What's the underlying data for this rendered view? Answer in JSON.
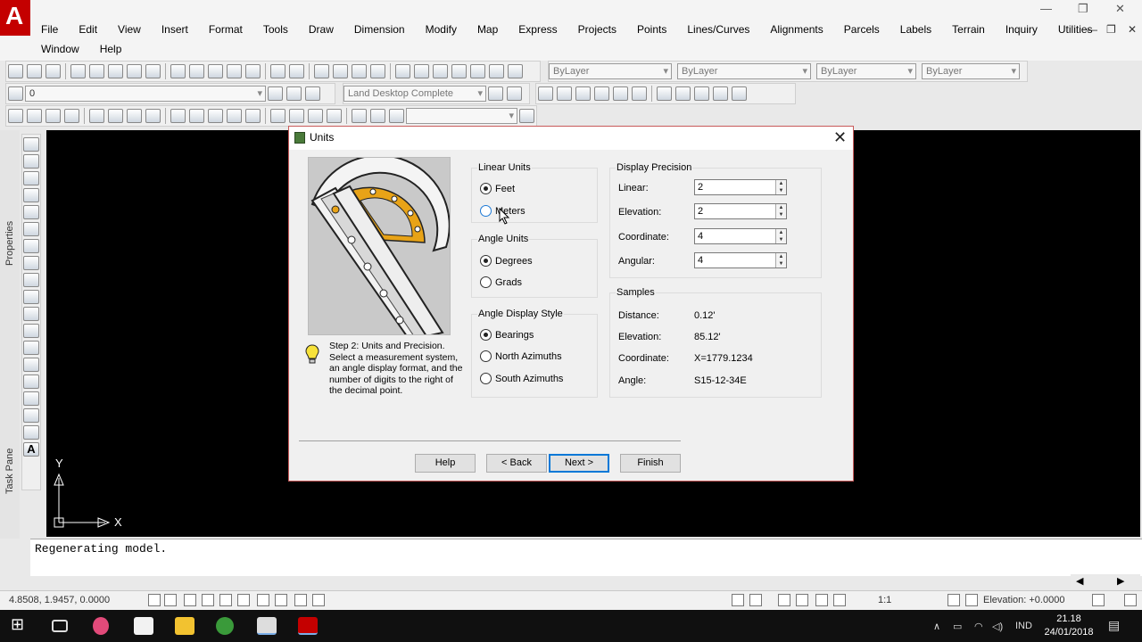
{
  "menu": {
    "row1": [
      "File",
      "Edit",
      "View",
      "Insert",
      "Format",
      "Tools",
      "Draw",
      "Dimension",
      "Modify",
      "Map",
      "Express",
      "Projects",
      "Points",
      "Lines/Curves",
      "Alignments",
      "Parcels",
      "Labels",
      "Terrain",
      "Inquiry",
      "Utilities"
    ],
    "row2": [
      "Window",
      "Help"
    ]
  },
  "toolbar": {
    "layer_value": "0",
    "workspace": "Land Desktop Complete",
    "color_combo": "ByLayer",
    "linetype_combo": "ByLayer",
    "lineweight_combo": "ByLayer",
    "plotstyle_combo": "ByLayer"
  },
  "side": {
    "properties_label": "Properties",
    "taskpane_label": "Task Pane"
  },
  "ucs": {
    "x_label": "X",
    "y_label": "Y"
  },
  "command": {
    "history": "Regenerating model."
  },
  "status": {
    "coords": "4.8508, 1.9457, 0.0000",
    "scale": "1:1",
    "elevation": "Elevation: +0.0000"
  },
  "taskbar": {
    "lang": "IND",
    "time": "21.18",
    "date": "24/01/2018"
  },
  "dialog": {
    "title": "Units",
    "step_text": "Step 2:  Units and Precision. Select a measurement system, an angle display format, and the number of digits to the right of the decimal point.",
    "linear_units": {
      "label": "Linear Units",
      "options": [
        "Feet",
        "Meters"
      ],
      "selected": "Feet"
    },
    "angle_units": {
      "label": "Angle Units",
      "options": [
        "Degrees",
        "Grads"
      ],
      "selected": "Degrees"
    },
    "angle_display_style": {
      "label": "Angle Display Style",
      "options": [
        "Bearings",
        "North Azimuths",
        "South Azimuths"
      ],
      "selected": "Bearings"
    },
    "display_precision": {
      "label": "Display Precision",
      "linear_label": "Linear:",
      "linear_value": "2",
      "elevation_label": "Elevation:",
      "elevation_value": "2",
      "coordinate_label": "Coordinate:",
      "coordinate_value": "4",
      "angular_label": "Angular:",
      "angular_value": "4"
    },
    "samples": {
      "label": "Samples",
      "distance_label": "Distance:",
      "distance_value": "0.12'",
      "elevation_label": "Elevation:",
      "elevation_value": "85.12'",
      "coordinate_label": "Coordinate:",
      "coordinate_value": "X=1779.1234",
      "angle_label": "Angle:",
      "angle_value": "S15-12-34E"
    },
    "buttons": {
      "help": "Help",
      "back": "< Back",
      "next": "Next >",
      "finish": "Finish"
    }
  },
  "colors": {
    "canvas": "#000000",
    "accent": "#0078d7",
    "logo": "#c40000",
    "protractor": "#e8a317"
  }
}
